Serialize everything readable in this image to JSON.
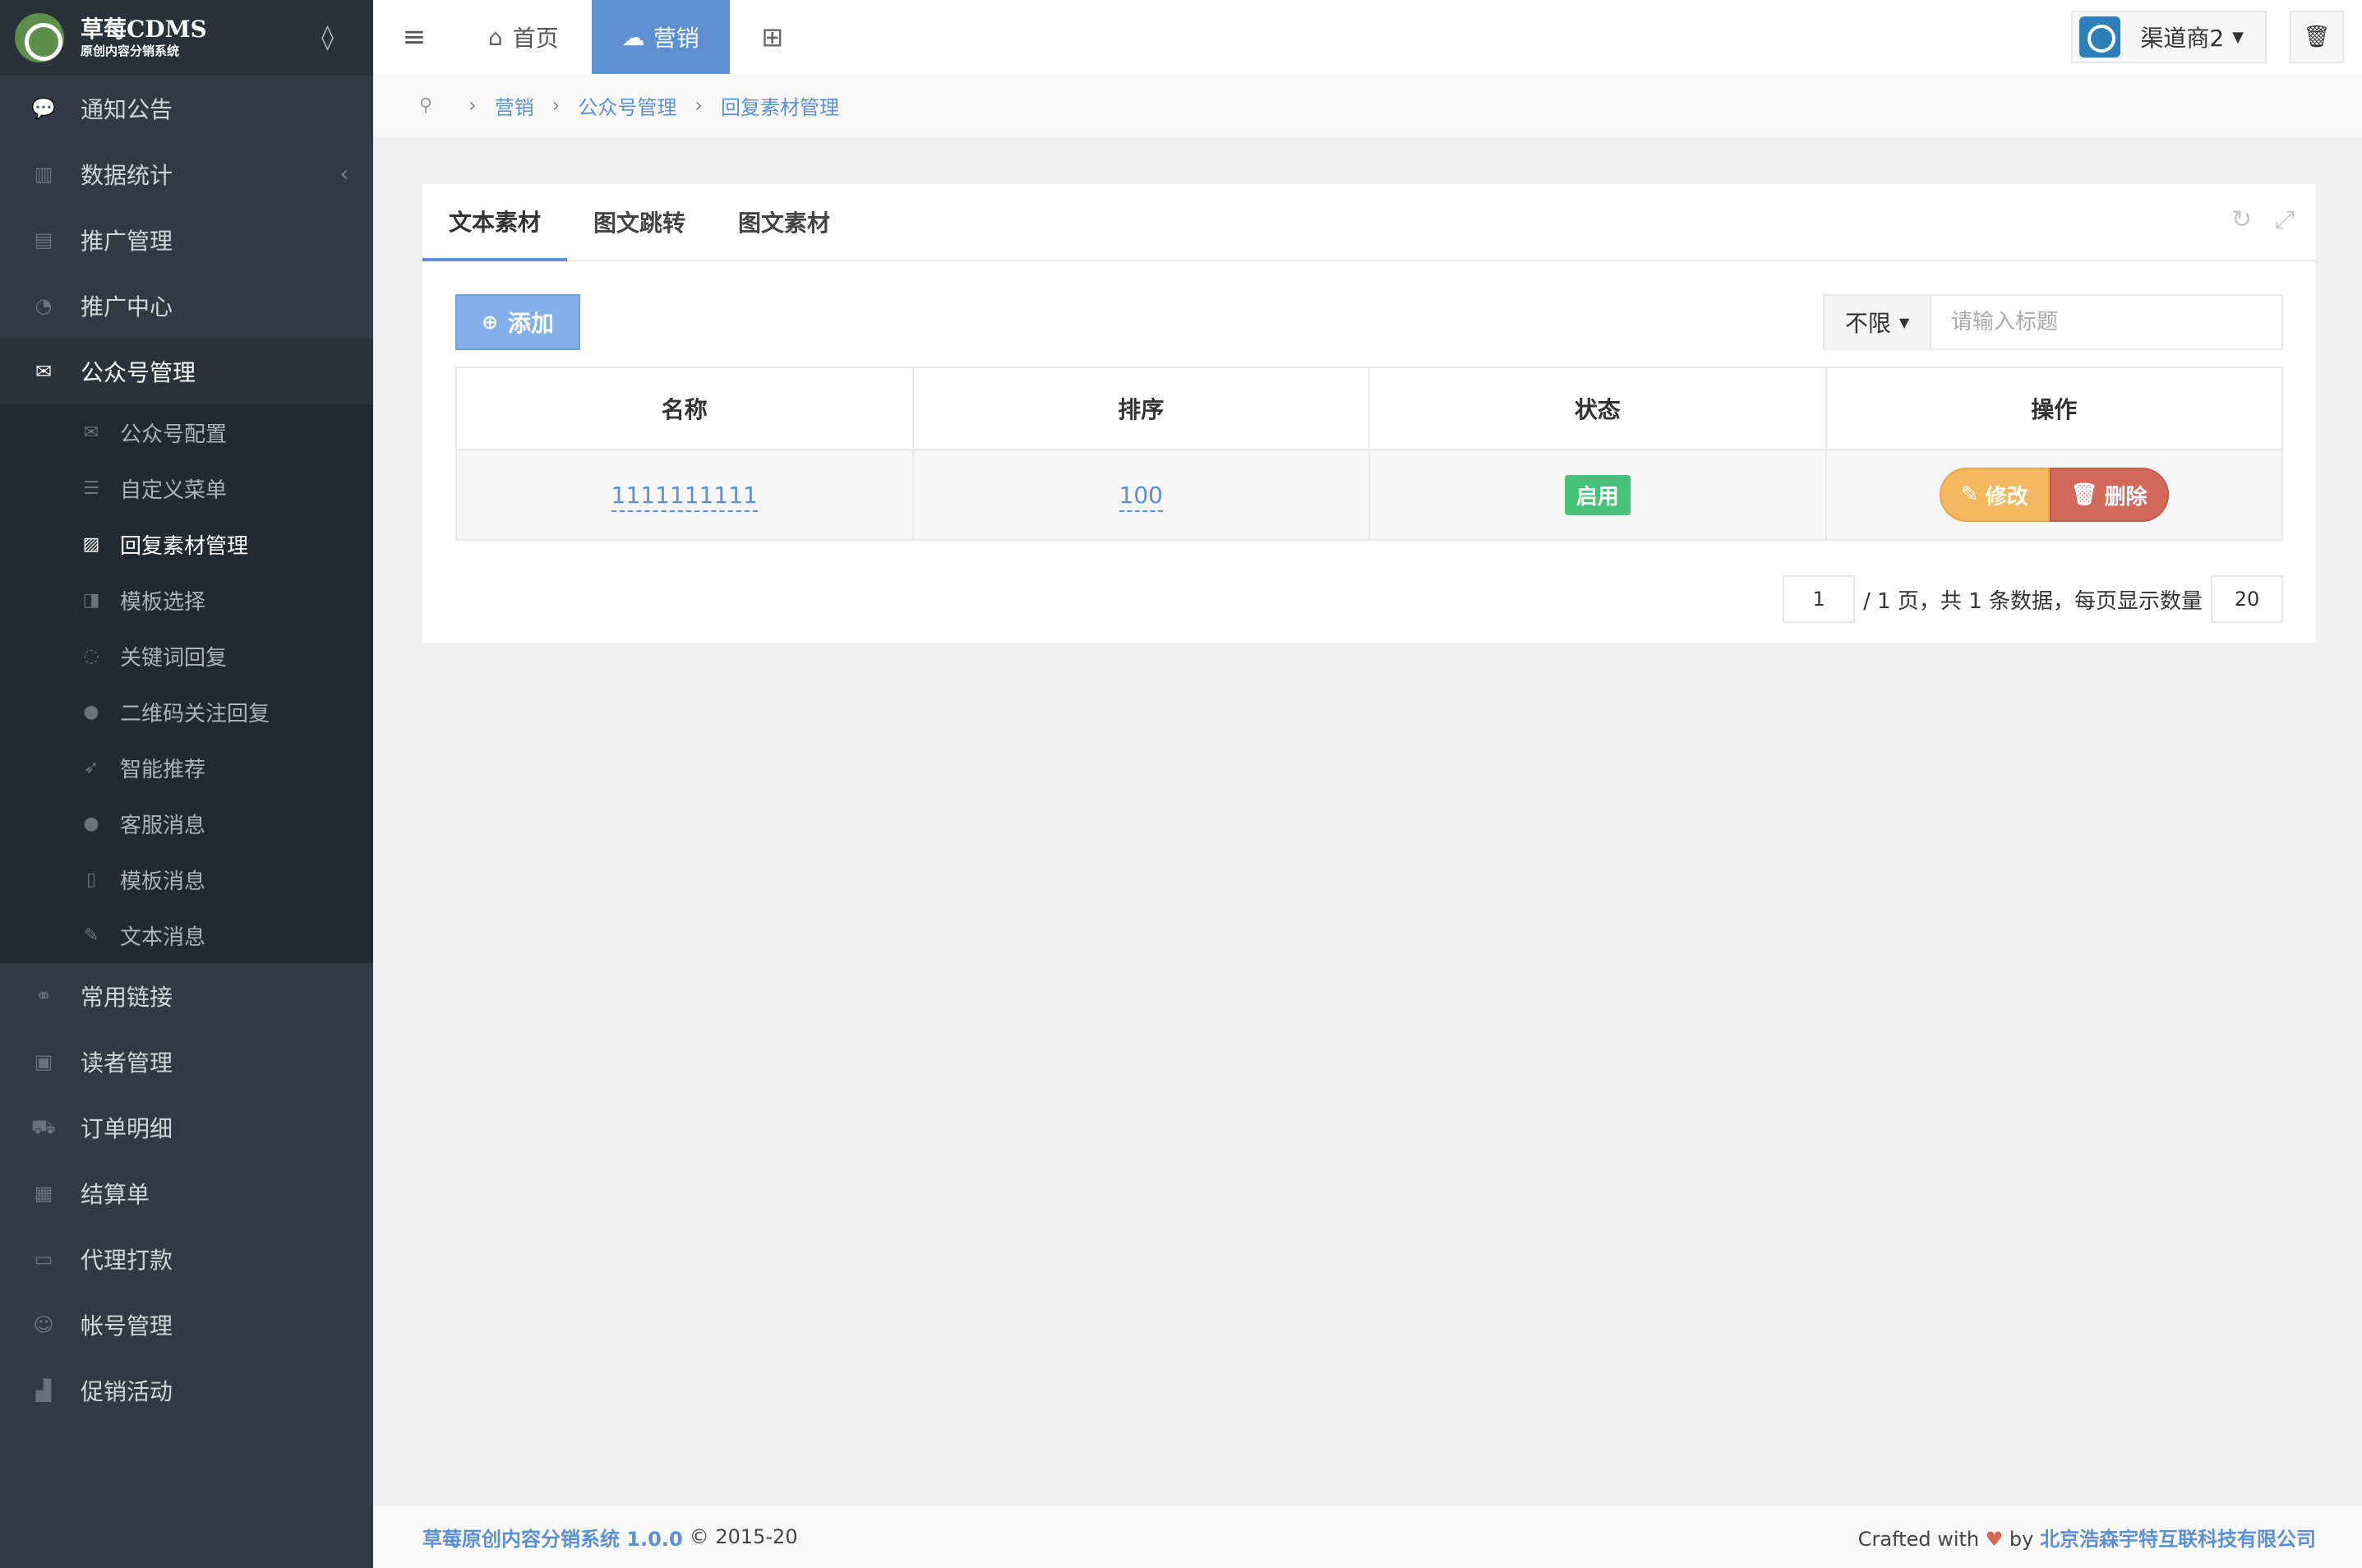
{
  "brand": {
    "title": "草莓CDMS",
    "subtitle": "原创内容分销系统"
  },
  "sidebar": {
    "items": [
      {
        "label": "通知公告",
        "icon": "comment-icon",
        "glyph": "💬"
      },
      {
        "label": "数据统计",
        "icon": "bar-chart-icon",
        "glyph": "▥"
      },
      {
        "label": "推广管理",
        "icon": "stack-icon",
        "glyph": "▤"
      },
      {
        "label": "推广中心",
        "icon": "user-circle-icon",
        "glyph": "◔"
      },
      {
        "label": "公众号管理",
        "icon": "wechat-icon",
        "glyph": "✉"
      },
      {
        "label": "常用链接",
        "icon": "link-icon",
        "glyph": "⚭"
      },
      {
        "label": "读者管理",
        "icon": "lock-icon",
        "glyph": "▣"
      },
      {
        "label": "订单明细",
        "icon": "cart-icon",
        "glyph": "⛟"
      },
      {
        "label": "结算单",
        "icon": "calculator-icon",
        "glyph": "▦"
      },
      {
        "label": "代理打款",
        "icon": "visa-icon",
        "glyph": "▭"
      },
      {
        "label": "帐号管理",
        "icon": "user-icon",
        "glyph": "☺"
      },
      {
        "label": "促销活动",
        "icon": "shopping-bag-icon",
        "glyph": "▟"
      }
    ],
    "submenu": [
      {
        "label": "公众号配置",
        "icon": "wechat-icon",
        "glyph": "✉"
      },
      {
        "label": "自定义菜单",
        "icon": "list-icon",
        "glyph": "☰"
      },
      {
        "label": "回复素材管理",
        "icon": "image-icon",
        "glyph": "▨"
      },
      {
        "label": "模板选择",
        "icon": "puzzle-icon",
        "glyph": "◨"
      },
      {
        "label": "关键词回复",
        "icon": "chat-icon",
        "glyph": "◌"
      },
      {
        "label": "二维码关注回复",
        "icon": "comment-icon",
        "glyph": "●"
      },
      {
        "label": "智能推荐",
        "icon": "paper-plane-icon",
        "glyph": "➶"
      },
      {
        "label": "客服消息",
        "icon": "user-icon",
        "glyph": "●"
      },
      {
        "label": "模板消息",
        "icon": "file-icon",
        "glyph": "▯"
      },
      {
        "label": "文本消息",
        "icon": "edit-icon",
        "glyph": "✎"
      }
    ]
  },
  "topbar": {
    "home_label": "首页",
    "market_label": "营销",
    "user_label": "渠道商2"
  },
  "breadcrumb": [
    "营销",
    "公众号管理",
    "回复素材管理"
  ],
  "tabs": [
    "文本素材",
    "图文跳转",
    "图文素材"
  ],
  "toolbar": {
    "add_label": "添加",
    "filter_value": "不限",
    "search_placeholder": "请输入标题"
  },
  "table": {
    "columns": [
      "名称",
      "排序",
      "状态",
      "操作"
    ],
    "rows": [
      {
        "name": "1111111111",
        "sort": "100",
        "status": "启用",
        "edit_label": "修改",
        "delete_label": "删除"
      }
    ]
  },
  "pager": {
    "current_page": "1",
    "total_pages_text": "/ 1 页，共 1 条数据，每页显示数量",
    "page_size": "20"
  },
  "footer": {
    "product": "草莓原创内容分销系统 1.0.0",
    "copyright": "© 2015-20",
    "crafted": "Crafted with",
    "by": "by",
    "company": "北京浩森宇特互联科技有限公司"
  },
  "colors": {
    "sidebar_bg": "#323a45",
    "primary": "#5c90d2",
    "success": "#46c37b",
    "warning": "#f3b760",
    "danger": "#d26a5c"
  }
}
